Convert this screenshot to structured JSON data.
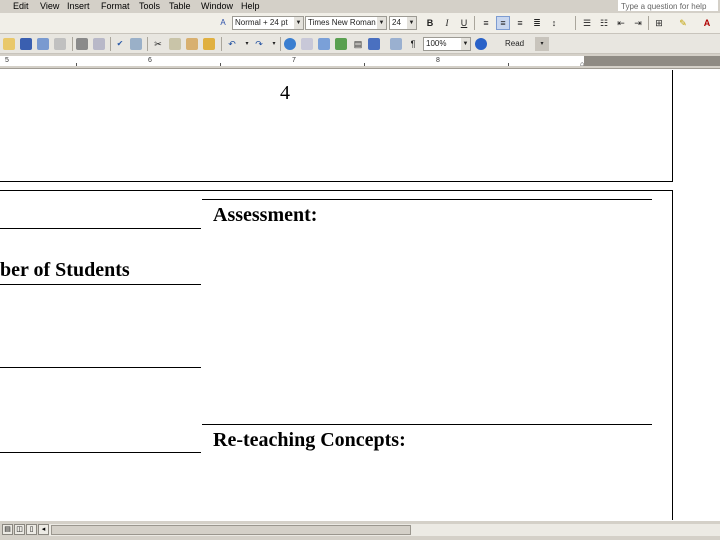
{
  "menu": {
    "items": [
      "Edit",
      "View",
      "Insert",
      "Format",
      "Tools",
      "Table",
      "Window",
      "Help"
    ],
    "ask_placeholder": "Type a question for help"
  },
  "formatting": {
    "style": "Normal + 24 pt",
    "font": "Times New Roman",
    "size": "24",
    "bold": "B",
    "italic": "I",
    "underline": "U"
  },
  "standard": {
    "zoom": "100%",
    "read_label": "Read",
    "pilcrow": "¶"
  },
  "ruler": {
    "marks": [
      "5",
      "6",
      "7",
      "8"
    ]
  },
  "document": {
    "page_number": "4",
    "assessment_heading": "Assessment:",
    "students_heading": "ber of Students",
    "reteaching_heading": "Re-teaching Concepts:"
  },
  "colors": {
    "chrome": "#d4d0c8",
    "toolbar": "#e8e6e0",
    "active_button": "#c9d7ef"
  }
}
